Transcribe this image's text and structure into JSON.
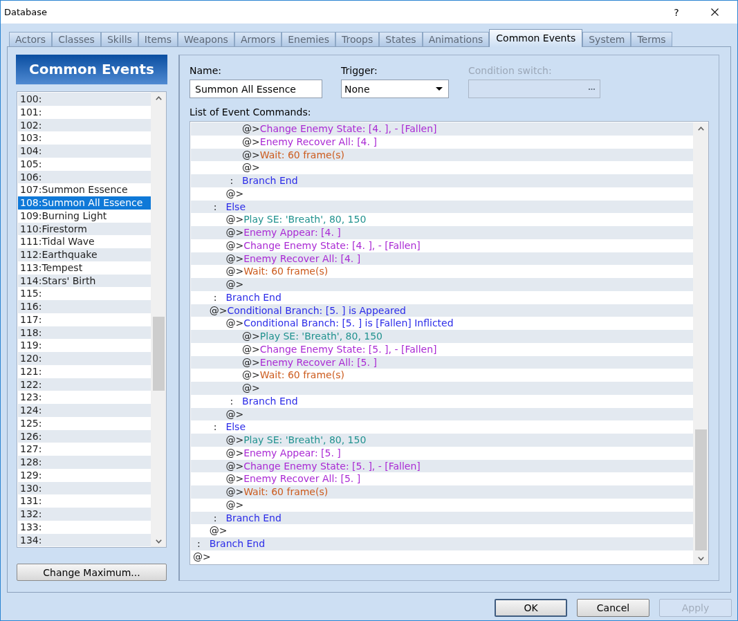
{
  "window": {
    "title": "Database",
    "help_button": "?"
  },
  "tabs": [
    {
      "label": "Actors",
      "selected": false
    },
    {
      "label": "Classes",
      "selected": false
    },
    {
      "label": "Skills",
      "selected": false
    },
    {
      "label": "Items",
      "selected": false
    },
    {
      "label": "Weapons",
      "selected": false
    },
    {
      "label": "Armors",
      "selected": false
    },
    {
      "label": "Enemies",
      "selected": false
    },
    {
      "label": "Troops",
      "selected": false
    },
    {
      "label": "States",
      "selected": false
    },
    {
      "label": "Animations",
      "selected": false
    },
    {
      "label": "Common Events",
      "selected": true
    },
    {
      "label": "System",
      "selected": false
    },
    {
      "label": "Terms",
      "selected": false
    }
  ],
  "common_events": {
    "header": "Common Events",
    "items": [
      {
        "label": "100:",
        "selected": false
      },
      {
        "label": "101:",
        "selected": false
      },
      {
        "label": "102:",
        "selected": false
      },
      {
        "label": "103:",
        "selected": false
      },
      {
        "label": "104:",
        "selected": false
      },
      {
        "label": "105:",
        "selected": false
      },
      {
        "label": "106:",
        "selected": false
      },
      {
        "label": "107:Summon Essence",
        "selected": false
      },
      {
        "label": "108:Summon All Essence",
        "selected": true
      },
      {
        "label": "109:Burning Light",
        "selected": false
      },
      {
        "label": "110:Firestorm",
        "selected": false
      },
      {
        "label": "111:Tidal Wave",
        "selected": false
      },
      {
        "label": "112:Earthquake",
        "selected": false
      },
      {
        "label": "113:Tempest",
        "selected": false
      },
      {
        "label": "114:Stars' Birth",
        "selected": false
      },
      {
        "label": "115:",
        "selected": false
      },
      {
        "label": "116:",
        "selected": false
      },
      {
        "label": "117:",
        "selected": false
      },
      {
        "label": "118:",
        "selected": false
      },
      {
        "label": "119:",
        "selected": false
      },
      {
        "label": "120:",
        "selected": false
      },
      {
        "label": "121:",
        "selected": false
      },
      {
        "label": "122:",
        "selected": false
      },
      {
        "label": "123:",
        "selected": false
      },
      {
        "label": "124:",
        "selected": false
      },
      {
        "label": "125:",
        "selected": false
      },
      {
        "label": "126:",
        "selected": false
      },
      {
        "label": "127:",
        "selected": false
      },
      {
        "label": "128:",
        "selected": false
      },
      {
        "label": "129:",
        "selected": false
      },
      {
        "label": "130:",
        "selected": false
      },
      {
        "label": "131:",
        "selected": false
      },
      {
        "label": "132:",
        "selected": false
      },
      {
        "label": "133:",
        "selected": false
      },
      {
        "label": "134:",
        "selected": false
      }
    ],
    "change_maximum_button": "Change Maximum..."
  },
  "event": {
    "name": {
      "label": "Name:",
      "value": "Summon All Essence"
    },
    "trigger": {
      "label": "Trigger:",
      "value": "None"
    },
    "condition_switch": {
      "label": "Condition switch:",
      "disabled": true
    },
    "commands_label": "List of Event Commands:",
    "commands": [
      {
        "children": [
          {
            "children": [
              {
                "children": [
                  {
                    "marker": "@>",
                    "command": "Change Enemy State: [4. ], - [Fallen]",
                    "kind": "enemy"
                  },
                  {
                    "marker": "@>",
                    "command": "Enemy Recover All: [4. ]",
                    "kind": "enemy"
                  },
                  {
                    "marker": "@>",
                    "command": "Wait: 60 frame(s)",
                    "kind": "wait"
                  },
                  {
                    "marker": "@>",
                    "kind": "blank"
                  }
                ]
              },
              {
                "marker": ":",
                "command": "Branch End",
                "kind": "clause"
              },
              {
                "marker": "@>",
                "kind": "blank"
              }
            ]
          },
          {
            "marker": ":",
            "command": "Else",
            "kind": "clause",
            "children": [
              {
                "marker": "@>",
                "command": "Play SE: 'Breath', 80, 150",
                "kind": "sound"
              },
              {
                "marker": "@>",
                "command": "Enemy Appear: [4. ]",
                "kind": "enemy"
              },
              {
                "marker": "@>",
                "command": "Change Enemy State: [4. ], - [Fallen]",
                "kind": "enemy"
              },
              {
                "marker": "@>",
                "command": "Enemy Recover All: [4. ]",
                "kind": "enemy"
              },
              {
                "marker": "@>",
                "command": "Wait: 60 frame(s)",
                "kind": "wait"
              },
              {
                "marker": "@>",
                "kind": "blank"
              }
            ]
          },
          {
            "marker": ":",
            "command": "Branch End",
            "kind": "clause"
          },
          {
            "marker": "@>",
            "command": "Conditional Branch: [5. ] is Appeared",
            "kind": "branch",
            "children": [
              {
                "marker": "@>",
                "command": "Conditional Branch: [5. ] is [Fallen] Inflicted",
                "kind": "branch",
                "children": [
                  {
                    "marker": "@>",
                    "command": "Play SE: 'Breath', 80, 150",
                    "kind": "sound"
                  },
                  {
                    "marker": "@>",
                    "command": "Change Enemy State: [5. ], - [Fallen]",
                    "kind": "enemy"
                  },
                  {
                    "marker": "@>",
                    "command": "Enemy Recover All: [5. ]",
                    "kind": "enemy"
                  },
                  {
                    "marker": "@>",
                    "command": "Wait: 60 frame(s)",
                    "kind": "wait"
                  },
                  {
                    "marker": "@>",
                    "kind": "blank"
                  }
                ]
              },
              {
                "marker": ":",
                "command": "Branch End",
                "kind": "clause"
              },
              {
                "marker": "@>",
                "kind": "blank"
              }
            ]
          },
          {
            "marker": ":",
            "command": "Else",
            "kind": "clause",
            "children": [
              {
                "marker": "@>",
                "command": "Play SE: 'Breath', 80, 150",
                "kind": "sound"
              },
              {
                "marker": "@>",
                "command": "Enemy Appear: [5. ]",
                "kind": "enemy"
              },
              {
                "marker": "@>",
                "command": "Change Enemy State: [5. ], - [Fallen]",
                "kind": "enemy"
              },
              {
                "marker": "@>",
                "command": "Enemy Recover All: [5. ]",
                "kind": "enemy"
              },
              {
                "marker": "@>",
                "command": "Wait: 60 frame(s)",
                "kind": "wait"
              },
              {
                "marker": "@>",
                "kind": "blank"
              }
            ]
          },
          {
            "marker": ":",
            "command": "Branch End",
            "kind": "clause"
          },
          {
            "marker": "@>",
            "kind": "blank"
          }
        ]
      },
      {
        "marker": ":",
        "command": "Branch End",
        "kind": "clause"
      },
      {
        "marker": "@>",
        "kind": "blank"
      }
    ]
  },
  "buttons": [
    {
      "label": "OK",
      "default": true,
      "disabled": false
    },
    {
      "label": "Cancel",
      "default": false,
      "disabled": false
    },
    {
      "label": "Apply",
      "default": false,
      "disabled": true
    }
  ]
}
